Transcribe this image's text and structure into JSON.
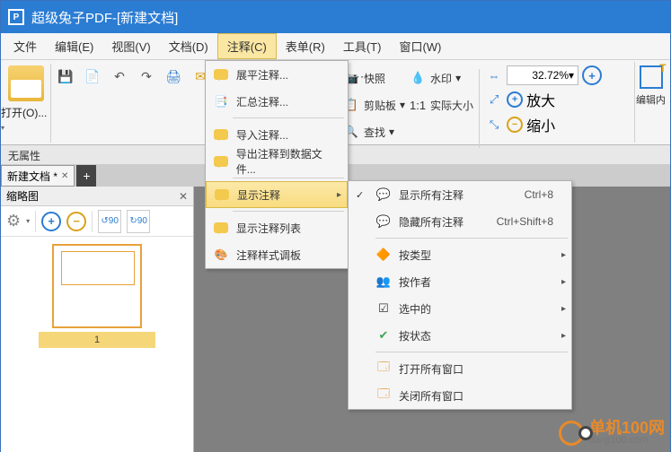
{
  "window": {
    "title": "超级兔子PDF-[新建文档]"
  },
  "menu": {
    "file": "文件",
    "edit": "编辑(E)",
    "view": "视图(V)",
    "doc": "文档(D)",
    "comment": "注释(C)",
    "form": "表单(R)",
    "tool": "工具(T)",
    "window": "窗口(W)"
  },
  "toolbar": {
    "open": "打开(O)...",
    "snapshot": "快照",
    "clipboard": "剪贴板",
    "find": "查找",
    "watermark": "水印",
    "actual_size": "实际大小",
    "zoom_value": "32.72%",
    "fit": "适合",
    "zoom_in": "放大",
    "zoom_out": "缩小",
    "edit_content": "编辑内"
  },
  "panel": {
    "no_attr": "无属性",
    "tab_name": "新建文档 *",
    "thumb_title": "缩略图",
    "page_num": "1"
  },
  "dropdown": {
    "flatten": "展平注释...",
    "summarize": "汇总注释...",
    "import": "导入注释...",
    "export": "导出注释到数据文件...",
    "show": "显示注释",
    "show_list": "显示注释列表",
    "style_panel": "注释样式调板"
  },
  "submenu": {
    "show_all": "显示所有注释",
    "sc_show_all": "Ctrl+8",
    "hide_all": "隐藏所有注释",
    "sc_hide_all": "Ctrl+Shift+8",
    "by_type": "按类型",
    "by_author": "按作者",
    "checked": "选中的",
    "by_status": "按状态",
    "open_all": "打开所有窗口",
    "close_all": "关闭所有窗口"
  },
  "wm": {
    "name": "单机100网",
    "url": "danji100.com"
  }
}
